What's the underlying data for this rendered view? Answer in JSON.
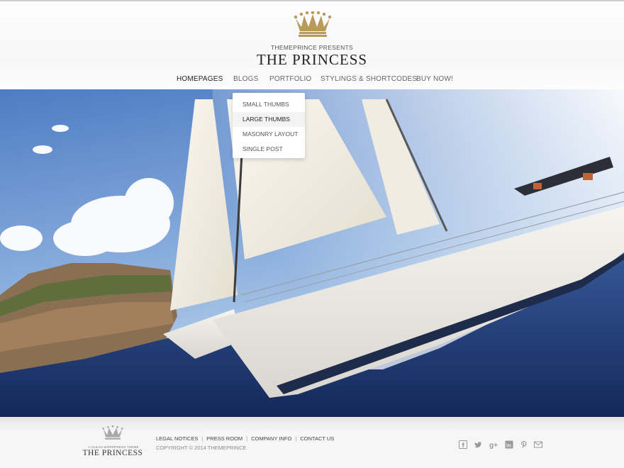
{
  "header": {
    "presents": "THEMEPRINCE PRESENTS",
    "title": "THE PRINCESS"
  },
  "nav": {
    "items": [
      {
        "label": "HOMEPAGES",
        "active": true
      },
      {
        "label": "BLOGS",
        "active": false
      },
      {
        "label": "PORTFOLIO",
        "active": false
      },
      {
        "label": "STYLINGS & SHORTCODES",
        "active": false
      },
      {
        "label": "BUY NOW!",
        "active": false
      }
    ]
  },
  "dropdown": {
    "parent": "BLOGS",
    "items": [
      {
        "label": "SMALL THUMBS"
      },
      {
        "label": "LARGE THUMBS",
        "hovered": true
      },
      {
        "label": "MASONRY LAYOUT"
      },
      {
        "label": "SINGLE POST"
      }
    ]
  },
  "hero": {
    "image": "sailboat-photo"
  },
  "footer": {
    "tagline": "A CLEAN WORDPRESS THEME",
    "title": "THE PRINCESS",
    "links": [
      "LEGAL NOTICES",
      "PRESS ROOM",
      "COMPANY INFO",
      "CONTACT US"
    ],
    "copyright": "COPYRIGHT © 2014 THEMEPRINCE",
    "social_icons": [
      "facebook-icon",
      "twitter-icon",
      "google-plus-icon",
      "linkedin-icon",
      "pinterest-icon",
      "mail-icon"
    ]
  },
  "colors": {
    "crown_gold": "#b89a5a",
    "text_dark": "#222222",
    "nav_text": "#666666",
    "sea_blue": "#1e3d78"
  }
}
